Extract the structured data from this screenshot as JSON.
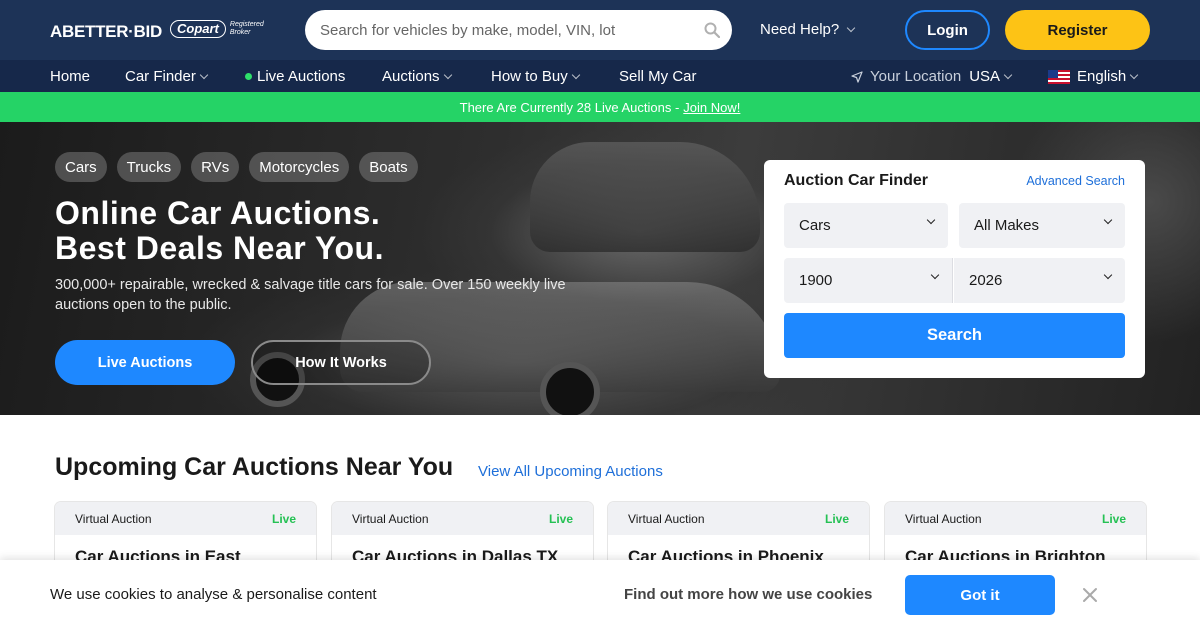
{
  "header": {
    "logo": "ABETTER·BID",
    "partner": "Copart",
    "partner_badge_top": "Registered",
    "partner_badge_bottom": "Broker",
    "search_placeholder": "Search for vehicles by make, model, VIN, lot",
    "help_label": "Need Help?",
    "login_label": "Login",
    "register_label": "Register"
  },
  "nav": {
    "items": [
      {
        "label": "Home"
      },
      {
        "label": "Car Finder"
      },
      {
        "label": "Live Auctions"
      },
      {
        "label": "Auctions"
      },
      {
        "label": "How to Buy"
      },
      {
        "label": "Sell My Car"
      }
    ],
    "location_label": "Your Location",
    "location_value": "USA",
    "language": "English"
  },
  "banner": {
    "text": "There Are Currently 28 Live Auctions -",
    "link": "Join Now!"
  },
  "hero": {
    "chips": [
      "Cars",
      "Trucks",
      "RVs",
      "Motorcycles",
      "Boats"
    ],
    "title_line1": "Online Car Auctions.",
    "title_line2": "Best Deals Near You.",
    "subtitle": "300,000+ repairable, wrecked & salvage title cars for sale. Over 150 weekly live auctions open to the public.",
    "primary_button": "Live Auctions",
    "secondary_button": "How It Works"
  },
  "finder": {
    "title": "Auction Car Finder",
    "advanced_link": "Advanced Search",
    "vehicle_type": "Cars",
    "make": "All Makes",
    "year_from": "1900",
    "year_to": "2026",
    "search_label": "Search"
  },
  "upcoming": {
    "title": "Upcoming Car Auctions Near You",
    "view_all": "View All Upcoming Auctions",
    "cards": [
      {
        "type": "Virtual Auction",
        "status": "Live",
        "title": "Car Auctions in East"
      },
      {
        "type": "Virtual Auction",
        "status": "Live",
        "title": "Car Auctions in Dallas TX"
      },
      {
        "type": "Virtual Auction",
        "status": "Live",
        "title": "Car Auctions in Phoenix"
      },
      {
        "type": "Virtual Auction",
        "status": "Live",
        "title": "Car Auctions in Brighton"
      }
    ]
  },
  "cookie": {
    "text": "We use cookies to analyse & personalise content",
    "more": "Find out more how we use cookies",
    "accept": "Got it"
  },
  "colors": {
    "header_bg": "#1d3357",
    "nav_bg": "#16284a",
    "banner_bg": "#25d366",
    "accent_blue": "#1e88ff",
    "register_yellow": "#fdc315",
    "live_green": "#25c154"
  }
}
